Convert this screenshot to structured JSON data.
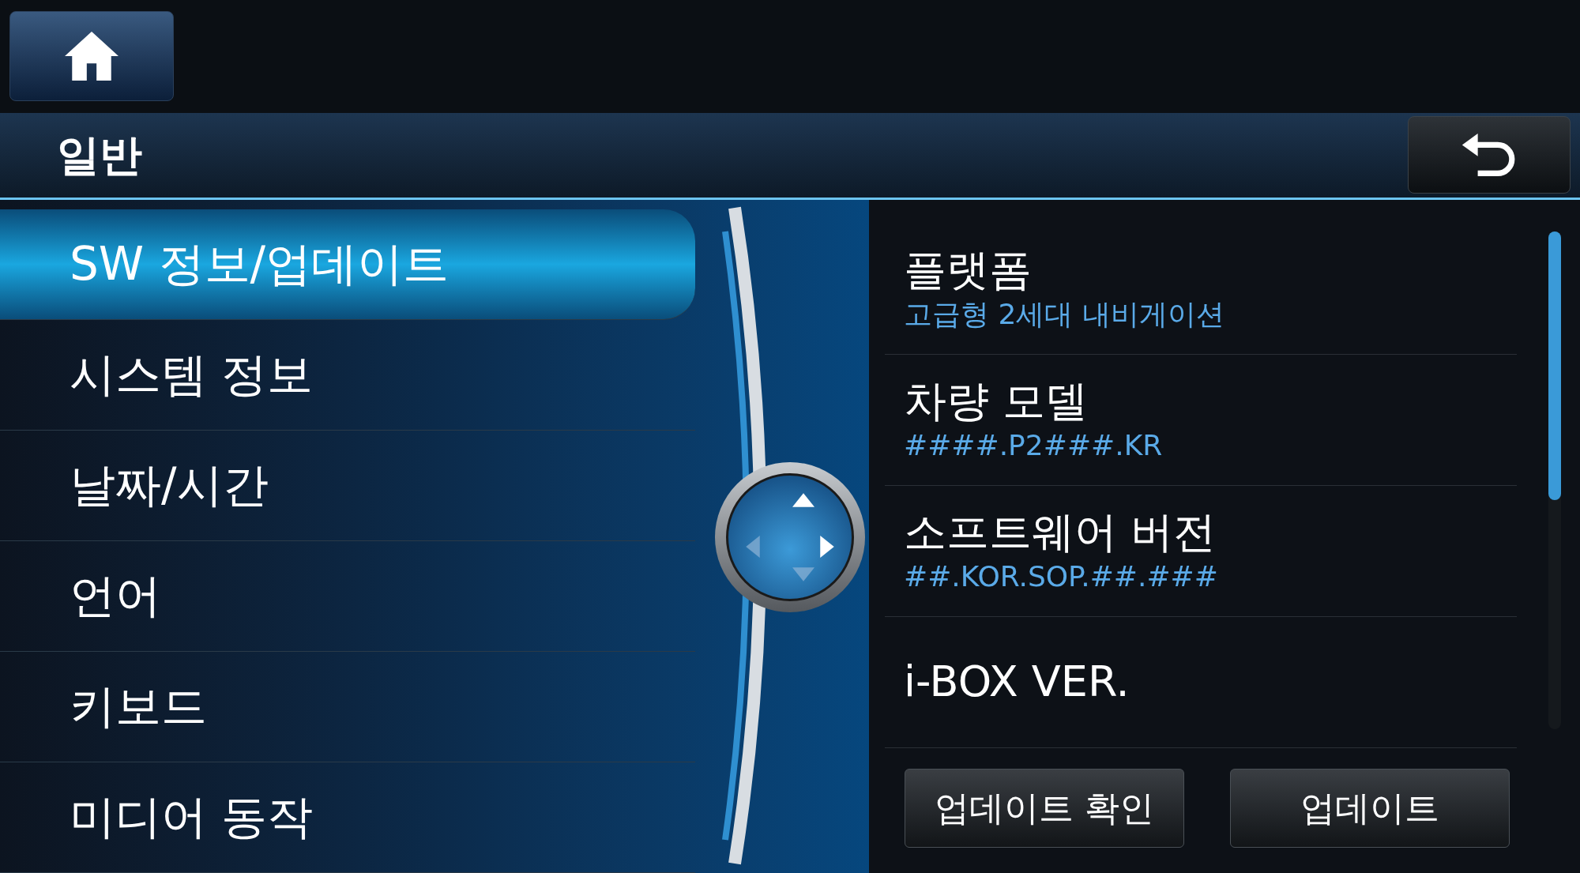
{
  "header": {
    "title": "일반"
  },
  "menu": [
    {
      "label": "SW 정보/업데이트",
      "selected": true
    },
    {
      "label": "시스템 정보",
      "selected": false
    },
    {
      "label": "날짜/시간",
      "selected": false
    },
    {
      "label": "언어",
      "selected": false
    },
    {
      "label": "키보드",
      "selected": false
    },
    {
      "label": "미디어 동작",
      "selected": false
    }
  ],
  "dpad": {
    "up": true,
    "right": true,
    "down": false,
    "left": false
  },
  "details": [
    {
      "title": "플랫폼",
      "value": "고급형 2세대 내비게이션"
    },
    {
      "title": "차량 모델",
      "value": "####.P2###.KR"
    },
    {
      "title": "소프트웨어 버전",
      "value": "##.KOR.SOP.##.###"
    },
    {
      "title": "i-BOX VER."
    }
  ],
  "buttons": [
    "업데이트 확인",
    "업데이트"
  ]
}
